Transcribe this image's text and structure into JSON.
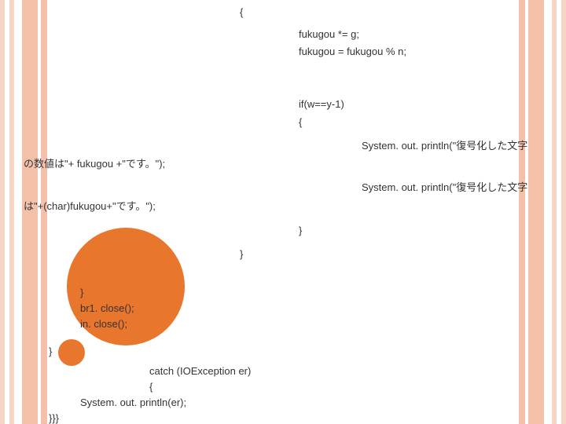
{
  "code": {
    "l1": "{",
    "l2": "fukugou *= g;",
    "l3": "fukugou = fukugou % n;",
    "l4": "if(w==y-1)",
    "l5": "{",
    "l6": "System. out. println(\"復号化した文字",
    "l7": "の数値は\"+ fukugou +\"です。\");",
    "l8": "System. out. println(\"復号化した文字",
    "l9": "は\"+(char)fukugou+\"です。\");",
    "l10": "}",
    "l11": "}",
    "l12": "}",
    "l13": "br1. close();",
    "l14": "in. close();",
    "l15": "}",
    "l16": "catch (IOException er)",
    "l17": "{",
    "l18": "System. out. println(er);",
    "l19": "}}}"
  }
}
